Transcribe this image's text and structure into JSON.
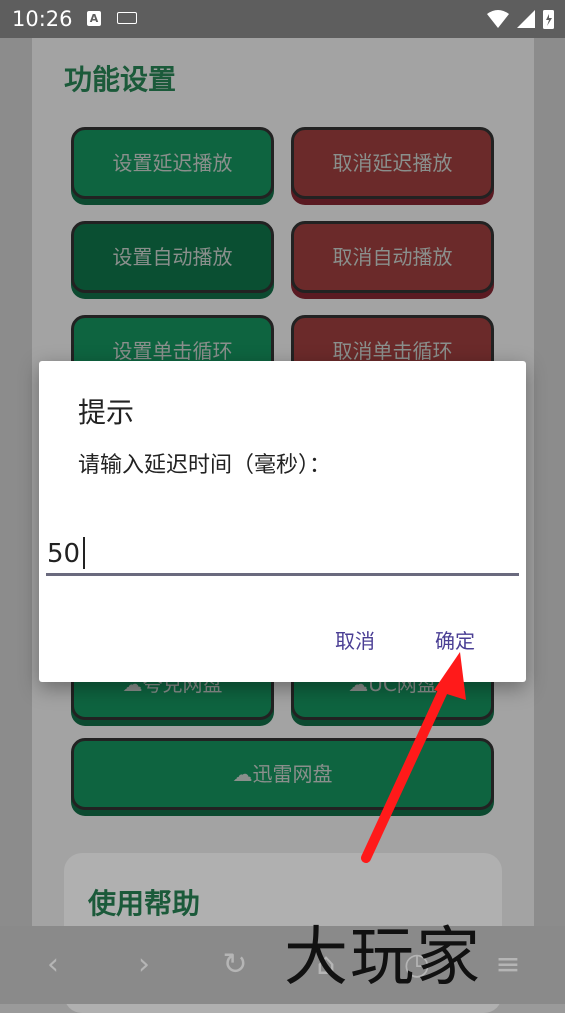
{
  "status_bar": {
    "time": "10:26",
    "notif_a": "A"
  },
  "page": {
    "section_title": "功能设置",
    "buttons": [
      {
        "label": "设置延迟播放"
      },
      {
        "label": "取消延迟播放"
      },
      {
        "label": "设置自动播放"
      },
      {
        "label": "取消自动播放"
      },
      {
        "label": "设置单击循环"
      },
      {
        "label": "取消单击循环"
      },
      {
        "label": "夸克网盘"
      },
      {
        "label": "UC网盘"
      },
      {
        "label": "迅雷网盘"
      }
    ],
    "help_title": "使用帮助"
  },
  "dialog": {
    "title": "提示",
    "message": "请输入延迟时间（毫秒）：",
    "input_value": "50",
    "cancel_label": "取消",
    "ok_label": "确定"
  },
  "watermark": "大玩家",
  "colors": {
    "accent": "#4a3e94",
    "green_button": "#0e6440",
    "red_button": "#6b2a2a",
    "arrow": "#ff1a1a"
  }
}
